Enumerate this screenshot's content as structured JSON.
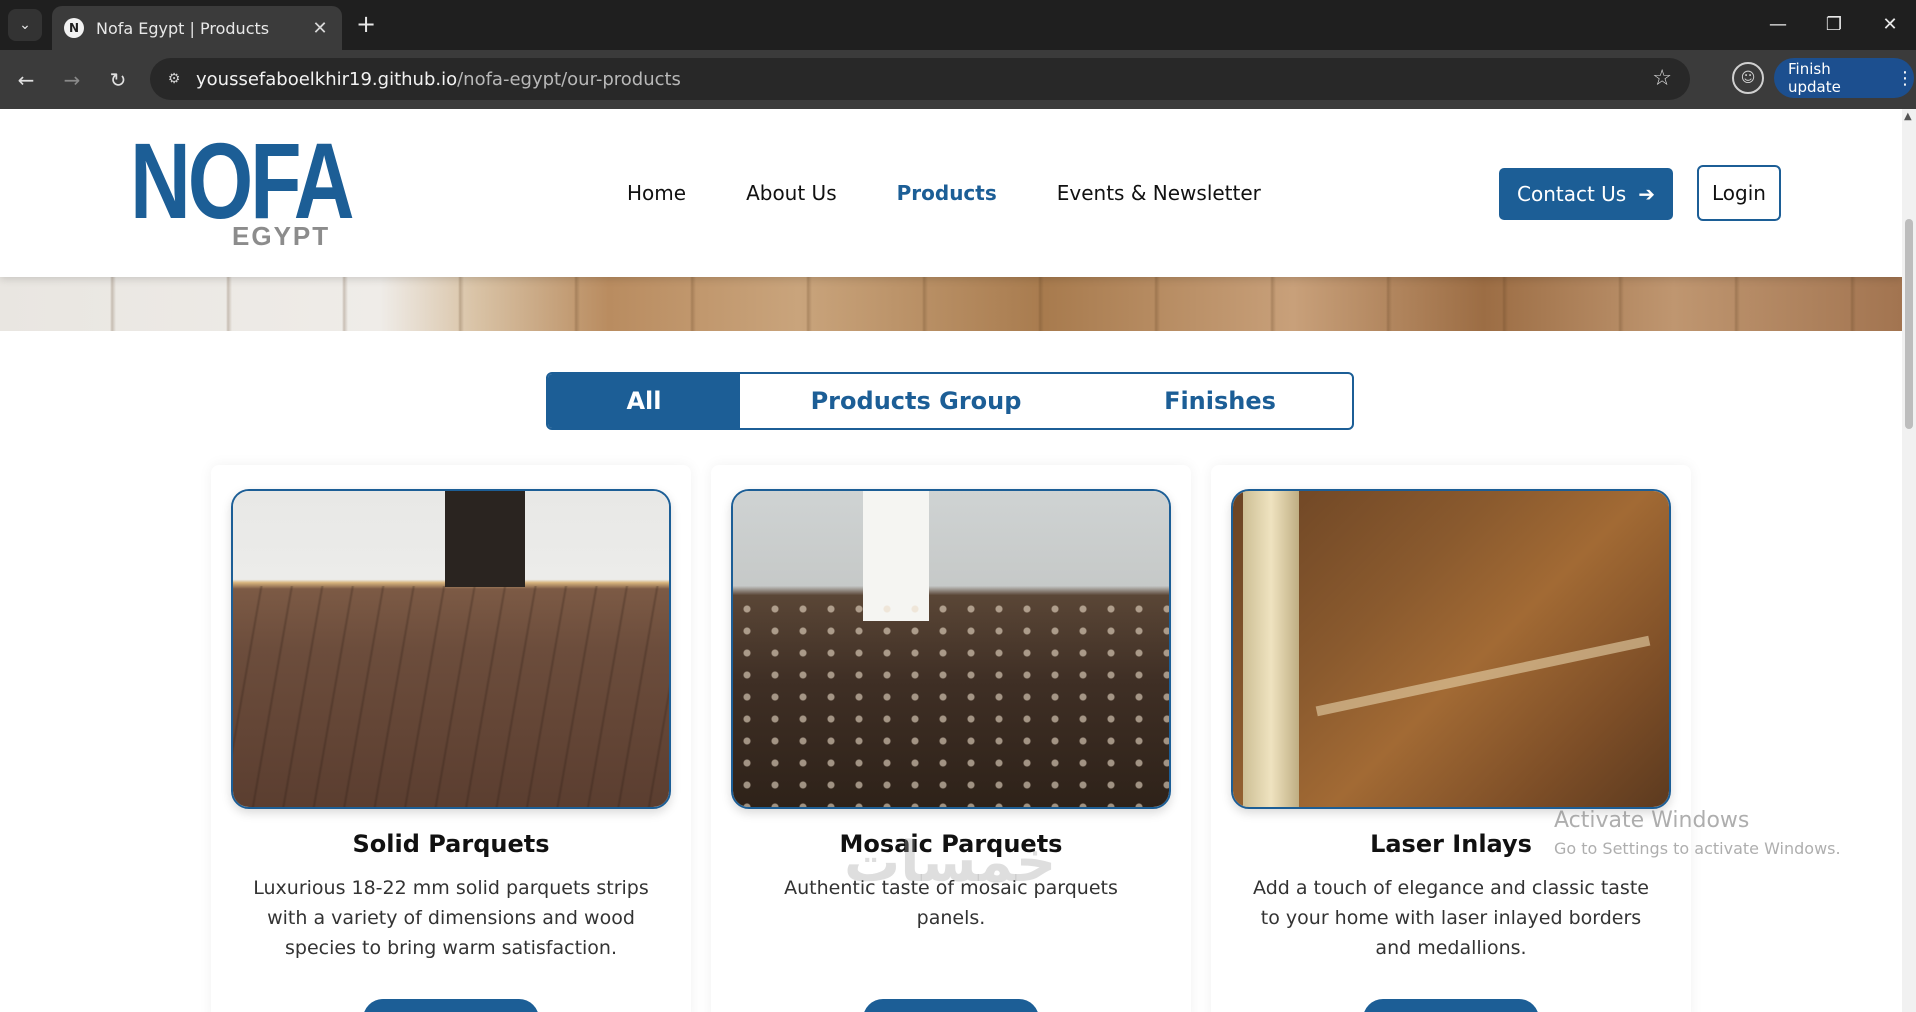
{
  "browser": {
    "tab_title": "Nofa Egypt | Products",
    "favicon_letter": "N",
    "url_host": "youssefaboelkhir19.github.io",
    "url_path": "/nofa-egypt/our-products",
    "finish_update_label": "Finish update"
  },
  "header": {
    "logo_main": "NOFA",
    "logo_sub": "EGYPT",
    "nav": [
      {
        "label": "Home"
      },
      {
        "label": "About Us"
      },
      {
        "label": "Products"
      },
      {
        "label": "Events & Newsletter"
      }
    ],
    "contact_label": "Contact Us",
    "login_label": "Login"
  },
  "filter": {
    "tabs": [
      {
        "label": "All"
      },
      {
        "label": "Products Group"
      },
      {
        "label": "Finishes"
      }
    ],
    "active": "All"
  },
  "products": [
    {
      "title": "Solid Parquets",
      "description": "Luxurious 18-22 mm solid parquets strips with a variety of dimensions and wood species to bring warm satisfaction."
    },
    {
      "title": "Mosaic Parquets",
      "description": "Authentic taste of mosaic parquets panels."
    },
    {
      "title": "Laser Inlays",
      "description": "Add a touch of elegance and classic taste to your home with laser inlayed borders and medallions."
    }
  ],
  "overlay": {
    "activate_title": "Activate Windows",
    "activate_sub": "Go to Settings to activate Windows.",
    "site_watermark": "خمسات"
  },
  "colors": {
    "brand_blue": "#1c5e96",
    "logo_grey": "#8c8c8c"
  }
}
